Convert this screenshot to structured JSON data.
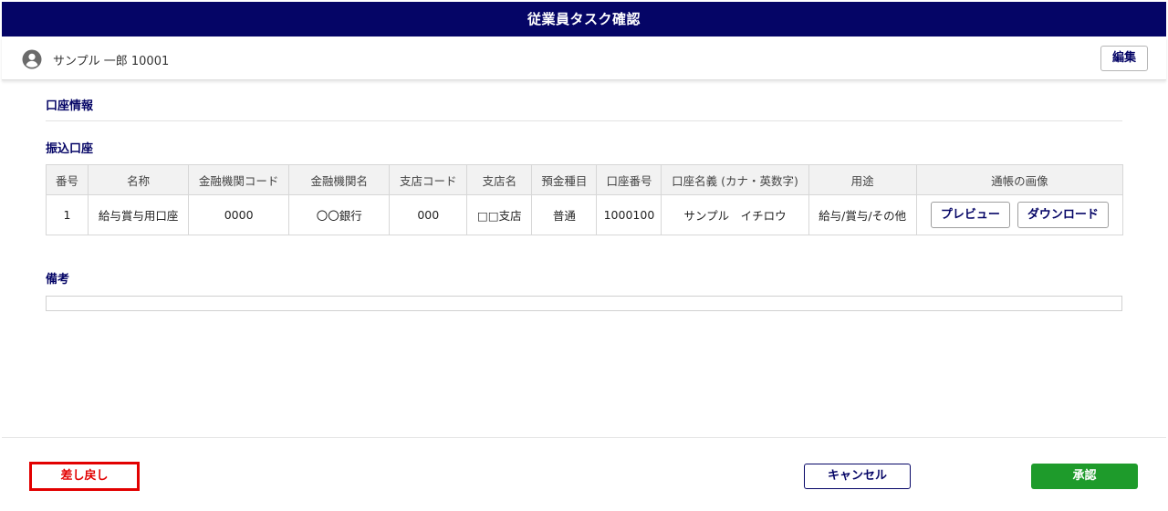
{
  "header": {
    "title": "従業員タスク確認"
  },
  "user": {
    "name": "サンプル 一郎 10001",
    "avatar_icon": "user-circle-icon",
    "edit_label": "編集"
  },
  "account_info": {
    "heading": "口座情報"
  },
  "transfer": {
    "heading": "振込口座",
    "columns": [
      "番号",
      "名称",
      "金融機関コード",
      "金融機関名",
      "支店コード",
      "支店名",
      "預金種目",
      "口座番号",
      "口座名義 (カナ・英数字)",
      "用途",
      "通帳の画像"
    ],
    "rows": [
      {
        "no": "1",
        "name": "給与賞与用口座",
        "bank_code": "0000",
        "bank_name": "〇〇銀行",
        "branch_code": "000",
        "branch_name": "□□支店",
        "deposit_type": "普通",
        "account_number": "1000100",
        "holder": "サンプル　イチロウ",
        "usage": "給与/賞与/その他",
        "preview_label": "プレビュー",
        "download_label": "ダウンロード"
      }
    ]
  },
  "remarks": {
    "heading": "備考",
    "value": ""
  },
  "footer": {
    "reject_label": "差し戻し",
    "cancel_label": "キャンセル",
    "approve_label": "承認"
  },
  "colors": {
    "navy": "#050566",
    "green": "#1e9b2b",
    "red": "#e20000"
  }
}
